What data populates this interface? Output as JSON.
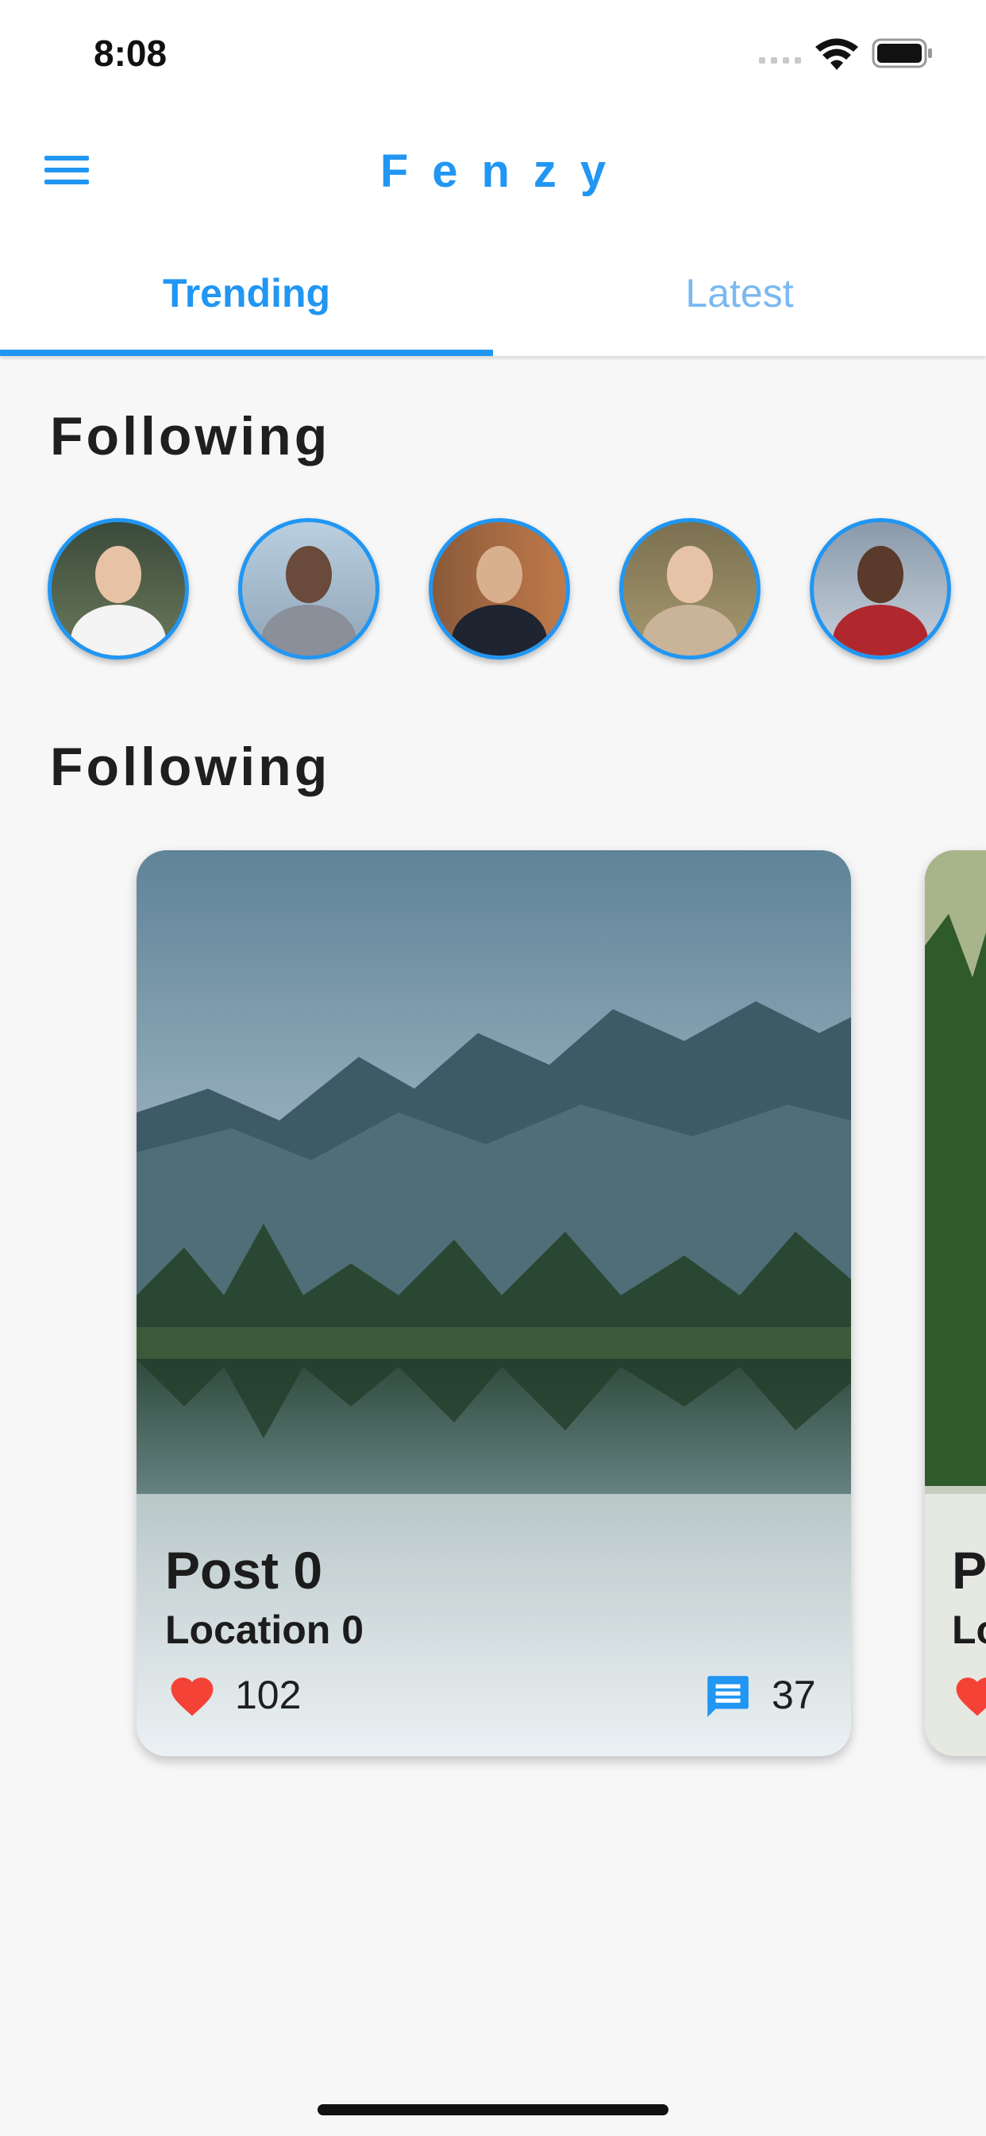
{
  "status_bar": {
    "time": "8:08"
  },
  "app_bar": {
    "title": "Fenzy"
  },
  "tabs": [
    {
      "label": "Trending",
      "selected": true
    },
    {
      "label": "Latest",
      "selected": false
    }
  ],
  "sections": {
    "following_title": "Following",
    "posts_title": "Following"
  },
  "following_avatars": [
    {
      "name": "avatar-1"
    },
    {
      "name": "avatar-2"
    },
    {
      "name": "avatar-3"
    },
    {
      "name": "avatar-4"
    },
    {
      "name": "avatar-5"
    }
  ],
  "posts": [
    {
      "title": "Post 0",
      "location": "Location 0",
      "likes": "102",
      "comments": "37"
    },
    {
      "title": "P",
      "location": "Lo"
    }
  ],
  "colors": {
    "accent": "#2196f3",
    "like": "#f44336"
  },
  "icons": {
    "menu": "menu-icon",
    "like": "heart-icon",
    "comment": "comment-icon"
  }
}
